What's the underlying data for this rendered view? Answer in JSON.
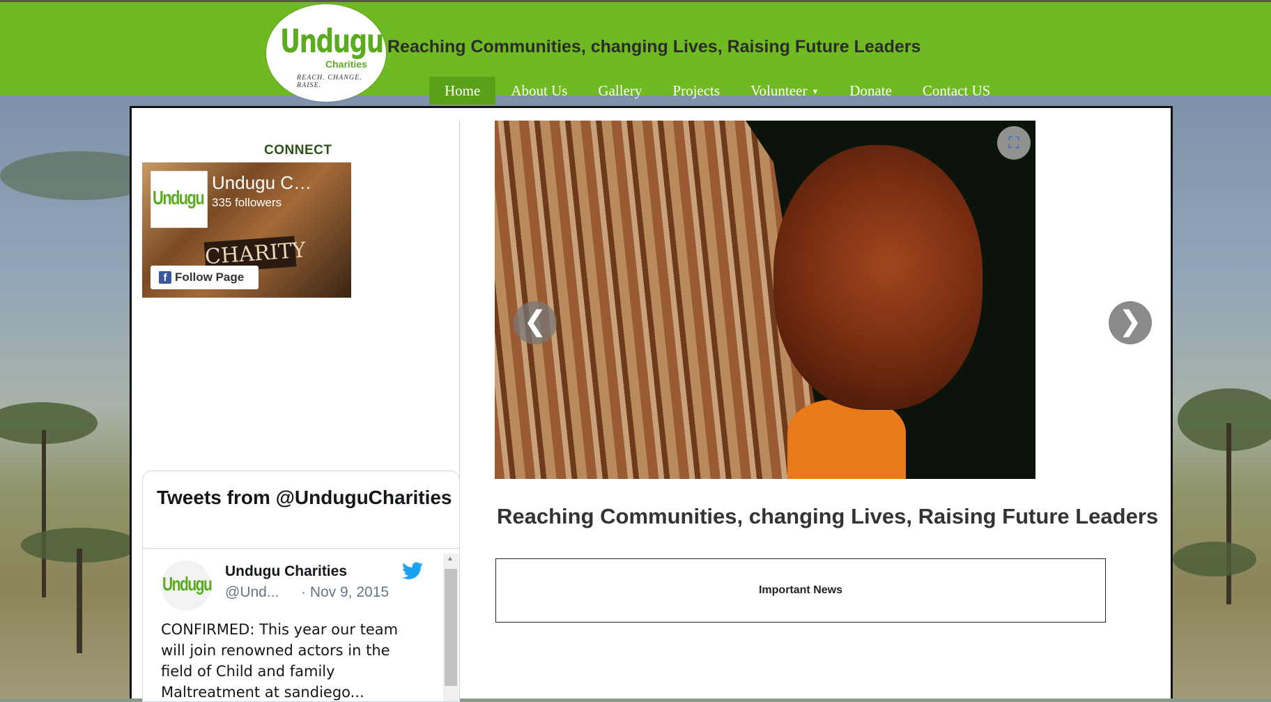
{
  "header": {
    "logo_word": "Undugu",
    "logo_sub": "Charities",
    "logo_tag": "REACH.   CHANGE.   RAISE.",
    "tagline": "Reaching Communities, changing Lives, Raising Future Leaders",
    "bg_color": "#6fba22"
  },
  "nav": {
    "items": [
      {
        "label": "Home",
        "active": true
      },
      {
        "label": "About Us"
      },
      {
        "label": "Gallery"
      },
      {
        "label": "Projects"
      },
      {
        "label": "Volunteer",
        "has_caret": true,
        "caret": "▼"
      },
      {
        "label": "Donate"
      },
      {
        "label": "Contact US"
      }
    ]
  },
  "sidebar": {
    "connect_heading": "CONNECT",
    "facebook": {
      "page_name": "Undugu C…",
      "followers": "335 followers",
      "logo_word": "Undugu",
      "cover_text": "CHARITY",
      "follow_label": "Follow Page",
      "icon": "facebook-icon"
    },
    "twitter": {
      "title": "Tweets from @UnduguCharities",
      "user": "Undugu Charities",
      "handle": "@Und...",
      "date": "· Nov 9, 2015",
      "avatar_word": "Undugu",
      "text": "CONFIRMED: This year our team will join renowned actors in the field of Child and family Maltreatment at sandiego...",
      "scroll_up": "▲",
      "icon": "twitter-bird-icon"
    }
  },
  "slider": {
    "prev_label": "❮",
    "next_label": "❯",
    "expand_label": "⛶"
  },
  "main": {
    "headline": "Reaching Communities, changing Lives, Raising Future Leaders",
    "news_box_label": "Important News"
  }
}
